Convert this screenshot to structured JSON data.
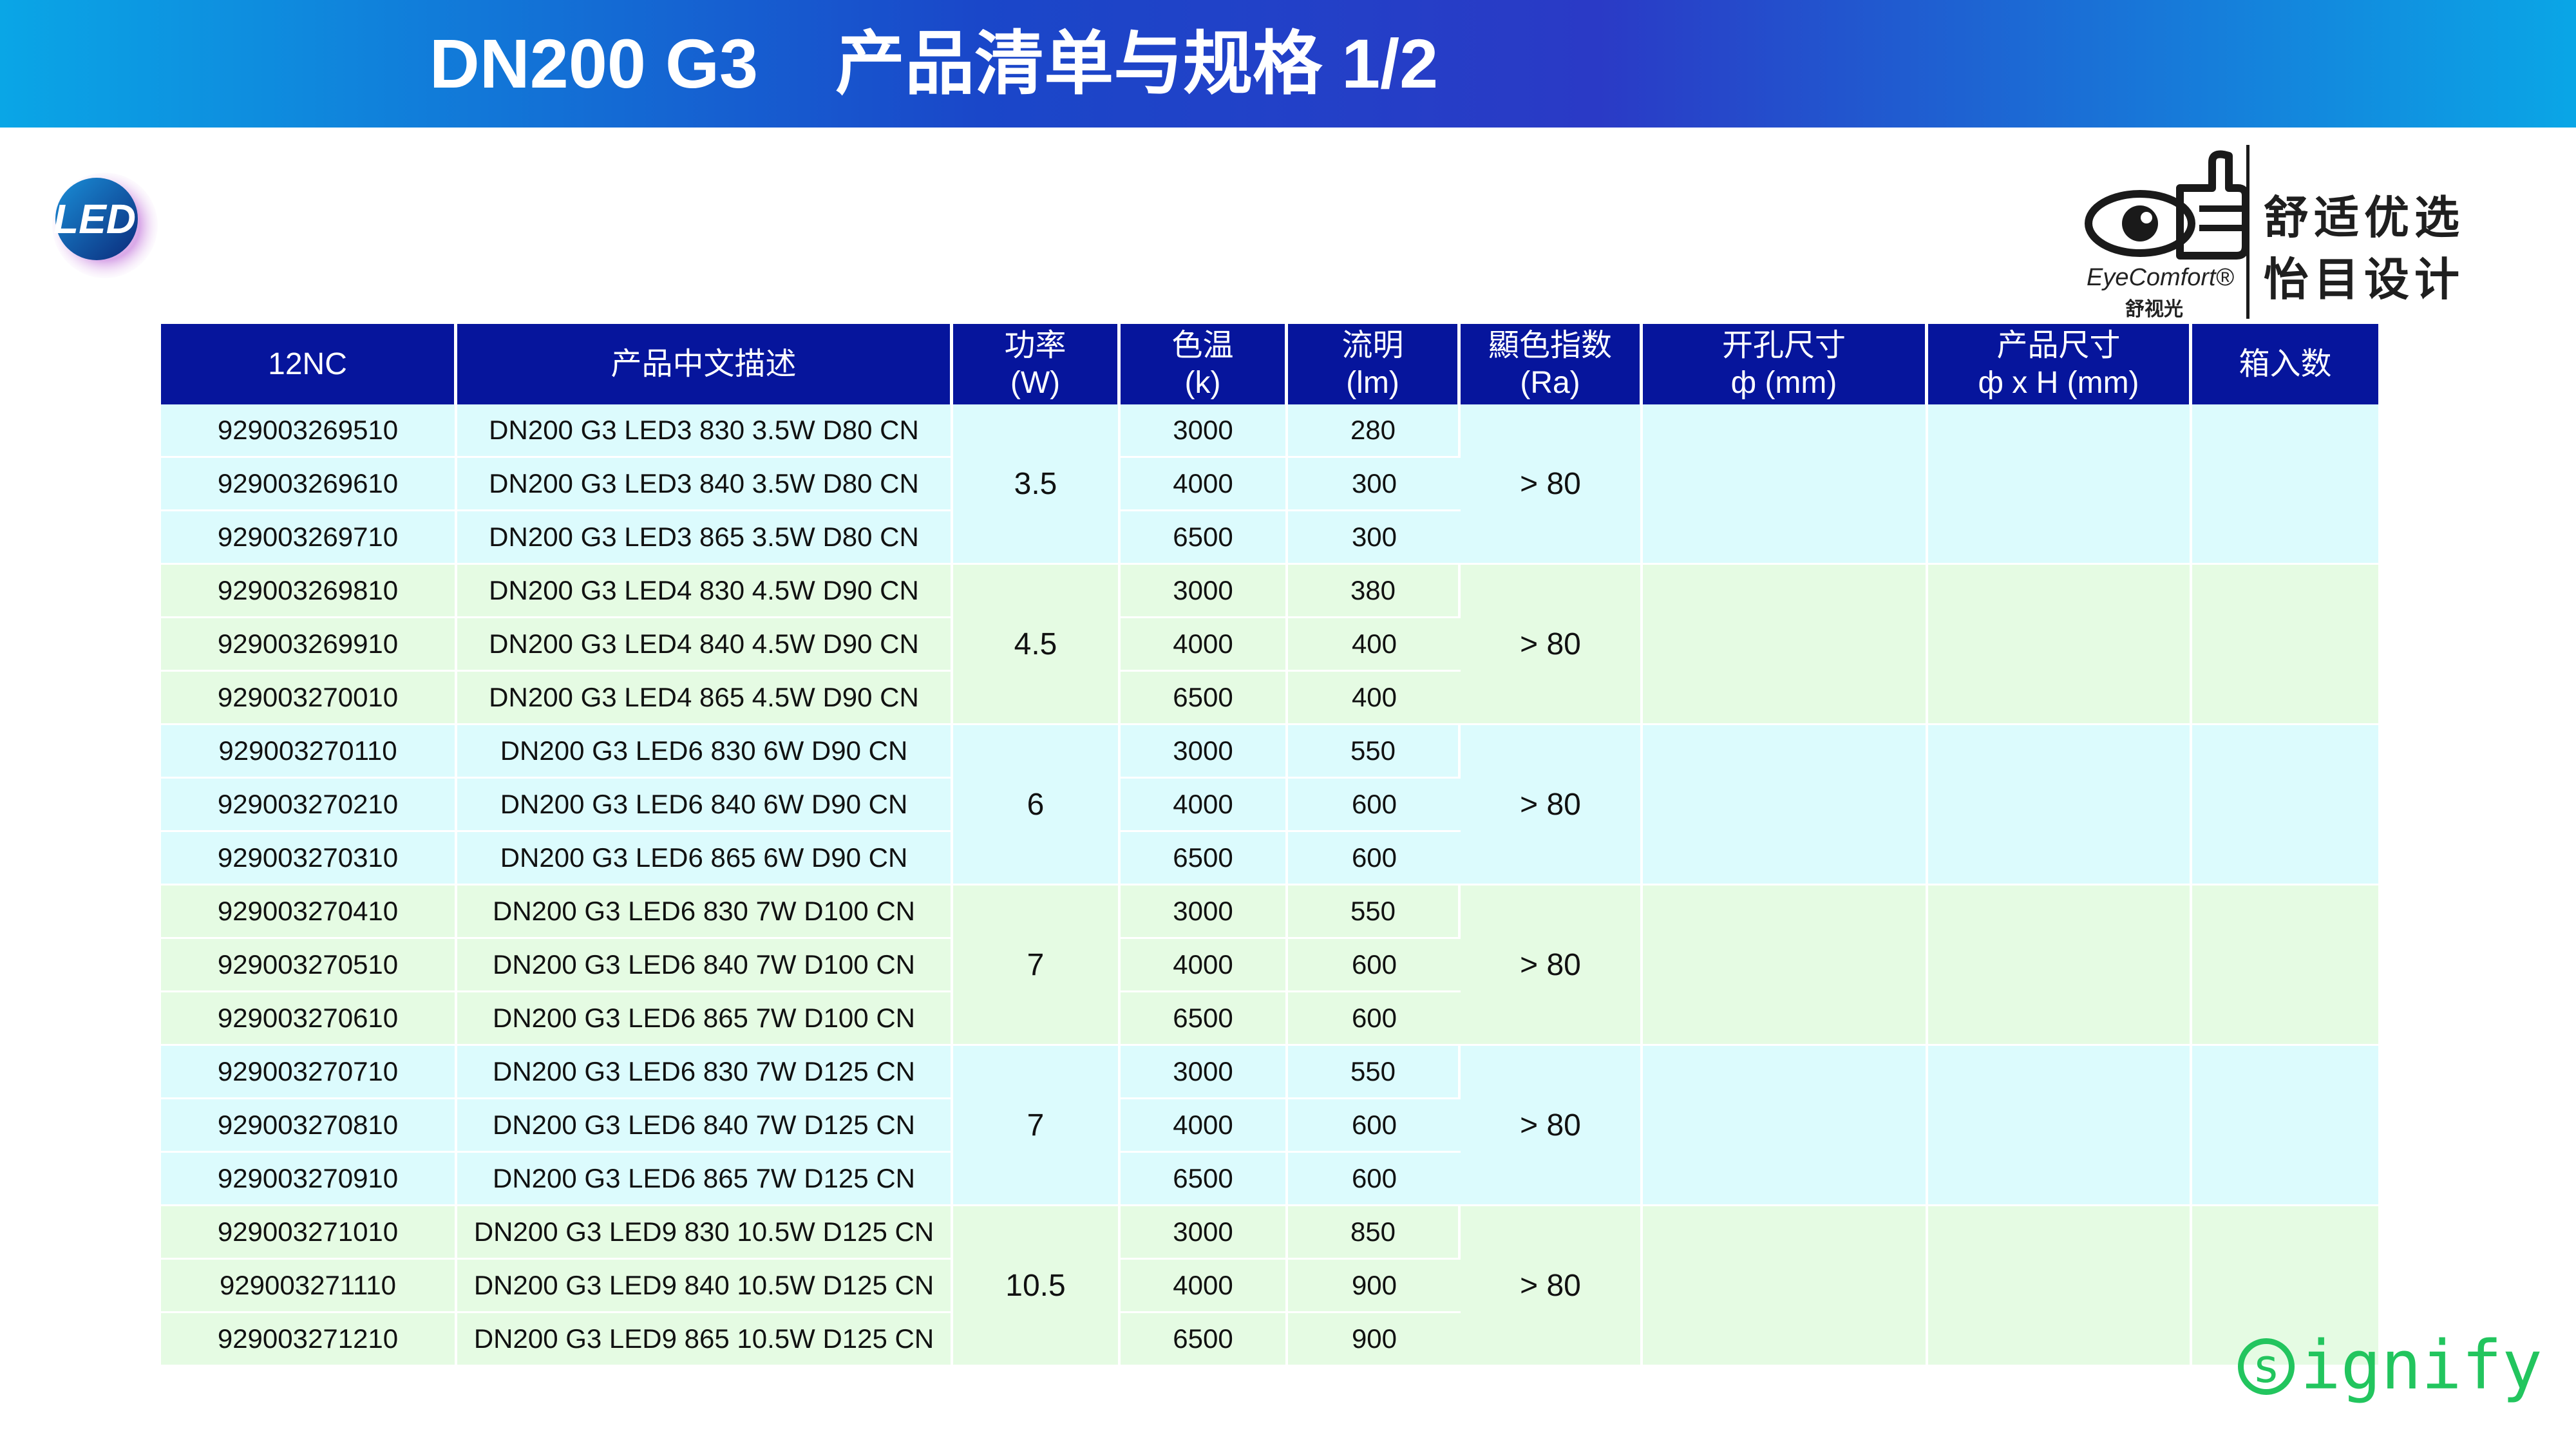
{
  "header": {
    "title": "DN200 G3    产品清单与规格 1/2",
    "bg_start": "#0aa6e6",
    "bg_mid": "#2a3ac6"
  },
  "logos": {
    "led_logo": "LED",
    "eyecomfort": {
      "brand": "EyeComfort®",
      "brand_cn": "舒视光",
      "slogan_line1": "舒适优选",
      "slogan_line2": "怡目设计"
    },
    "signify": {
      "s": "s",
      "rest": "ignify",
      "color": "#22c55e"
    }
  },
  "table": {
    "header_color": "#06159c",
    "columns": [
      {
        "l1": "12NC",
        "l2": ""
      },
      {
        "l1": "产品中文描述",
        "l2": ""
      },
      {
        "l1": "功率",
        "l2": "(W)"
      },
      {
        "l1": "色温",
        "l2": "(k)"
      },
      {
        "l1": "流明",
        "l2": "(lm)"
      },
      {
        "l1": "顯色指数",
        "l2": "(Ra)"
      },
      {
        "l1": "开孔尺寸",
        "l2": "ф (mm)"
      },
      {
        "l1": "产品尺寸",
        "l2": "ф x H (mm)"
      },
      {
        "l1": "箱入数",
        "l2": ""
      }
    ],
    "groups": [
      {
        "power": "3.5",
        "ra": "> 80",
        "color": "#dcfbfd",
        "rows": [
          {
            "nc": "929003269510",
            "desc": "DN200 G3 LED3 830 3.5W D80 CN",
            "cct": "3000",
            "lm": "280"
          },
          {
            "nc": "929003269610",
            "desc": "DN200 G3 LED3 840 3.5W D80 CN",
            "cct": "4000",
            "lm": "300"
          },
          {
            "nc": "929003269710",
            "desc": "DN200 G3 LED3 865 3.5W D80 CN",
            "cct": "6500",
            "lm": "300"
          }
        ]
      },
      {
        "power": "4.5",
        "ra": "> 80",
        "color": "#e5fbe3",
        "rows": [
          {
            "nc": "929003269810",
            "desc": "DN200 G3 LED4 830 4.5W D90 CN",
            "cct": "3000",
            "lm": "380"
          },
          {
            "nc": "929003269910",
            "desc": "DN200 G3 LED4 840 4.5W D90 CN",
            "cct": "4000",
            "lm": "400"
          },
          {
            "nc": "929003270010",
            "desc": "DN200 G3 LED4 865 4.5W D90 CN",
            "cct": "6500",
            "lm": "400"
          }
        ]
      },
      {
        "power": "6",
        "ra": "> 80",
        "color": "#dcfbfd",
        "rows": [
          {
            "nc": "929003270110",
            "desc": "DN200 G3 LED6 830 6W D90 CN",
            "cct": "3000",
            "lm": "550"
          },
          {
            "nc": "929003270210",
            "desc": "DN200 G3 LED6 840 6W D90 CN",
            "cct": "4000",
            "lm": "600"
          },
          {
            "nc": "929003270310",
            "desc": "DN200 G3 LED6 865 6W D90 CN",
            "cct": "6500",
            "lm": "600"
          }
        ]
      },
      {
        "power": "7",
        "ra": "> 80",
        "color": "#e5fbe3",
        "rows": [
          {
            "nc": "929003270410",
            "desc": "DN200 G3 LED6 830 7W D100 CN",
            "cct": "3000",
            "lm": "550"
          },
          {
            "nc": "929003270510",
            "desc": "DN200 G3 LED6 840 7W D100 CN",
            "cct": "4000",
            "lm": "600"
          },
          {
            "nc": "929003270610",
            "desc": "DN200 G3 LED6 865 7W D100 CN",
            "cct": "6500",
            "lm": "600"
          }
        ]
      },
      {
        "power": "7",
        "ra": "> 80",
        "color": "#dcfbfd",
        "rows": [
          {
            "nc": "929003270710",
            "desc": "DN200 G3 LED6 830 7W D125 CN",
            "cct": "3000",
            "lm": "550"
          },
          {
            "nc": "929003270810",
            "desc": "DN200 G3 LED6 840 7W D125 CN",
            "cct": "4000",
            "lm": "600"
          },
          {
            "nc": "929003270910",
            "desc": "DN200 G3 LED6 865 7W D125 CN",
            "cct": "6500",
            "lm": "600"
          }
        ]
      },
      {
        "power": "10.5",
        "ra": "> 80",
        "color": "#e5fbe3",
        "rows": [
          {
            "nc": "929003271010",
            "desc": "DN200 G3 LED9 830 10.5W D125 CN",
            "cct": "3000",
            "lm": "850"
          },
          {
            "nc": "929003271110",
            "desc": "DN200 G3 LED9 840 10.5W D125 CN",
            "cct": "4000",
            "lm": "900"
          },
          {
            "nc": "929003271210",
            "desc": "DN200 G3 LED9 865 10.5W D125 CN",
            "cct": "6500",
            "lm": "900"
          }
        ]
      }
    ]
  }
}
